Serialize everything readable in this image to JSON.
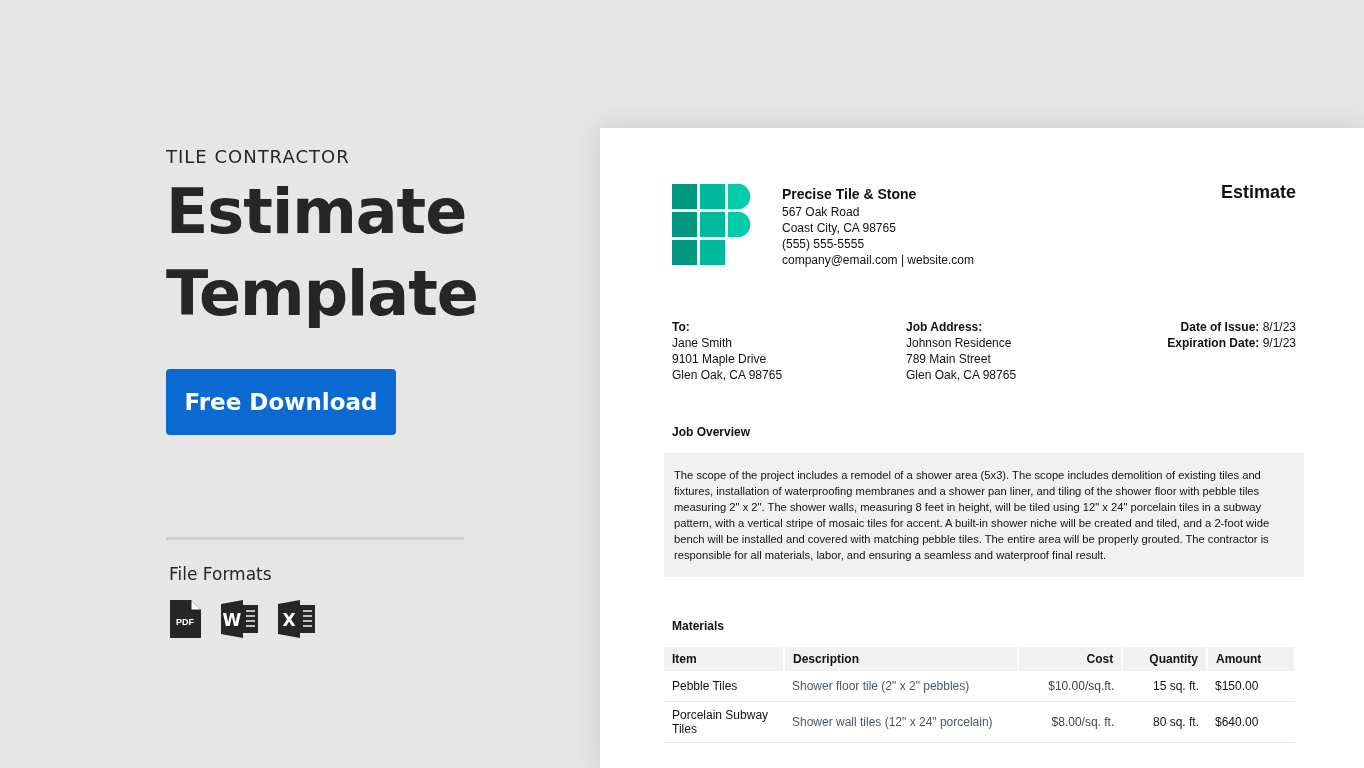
{
  "promo": {
    "eyebrow": "TILE CONTRACTOR",
    "title_lines": [
      "Estimate",
      "Template"
    ],
    "download_button": "Free Download",
    "formats_heading": "File Formats",
    "formats": [
      {
        "kind": "pdf",
        "label": "PDF"
      },
      {
        "kind": "word",
        "label": "W"
      },
      {
        "kind": "excel",
        "label": "X"
      }
    ]
  },
  "document": {
    "company": {
      "name": "Precise Tile & Stone",
      "lines": [
        "567 Oak Road",
        "Coast City, CA 98765",
        "(555) 555-5555",
        "company@email.com | website.com"
      ]
    },
    "doc_title": "Estimate",
    "to": {
      "heading": "To:",
      "lines": [
        "Jane Smith",
        "9101 Maple Drive",
        "Glen Oak, CA 98765"
      ]
    },
    "job_address": {
      "heading": "Job Address:",
      "lines": [
        "Johnson Residence",
        "789 Main Street",
        "Glen Oak, CA 98765"
      ]
    },
    "dates": [
      {
        "label": "Date of Issue:",
        "value": "8/1/23"
      },
      {
        "label": "Expiration Date:",
        "value": "9/1/23"
      }
    ],
    "overview_heading": "Job Overview",
    "overview_text": "The scope of the project includes a remodel of a shower area (5x3). The scope includes demolition of existing tiles and fixtures, installation of waterproofing membranes and a shower pan liner, and tiling of the shower floor with pebble tiles measuring 2\" x 2\". The shower walls, measuring 8 feet in height, will be tiled using 12\" x 24\" porcelain tiles in a subway pattern, with a vertical stripe of mosaic tiles for accent. A built-in shower niche will be created and tiled, and a 2-foot wide bench will be installed and covered with matching pebble tiles. The entire area will be properly grouted. The contractor is responsible for all materials, labor, and ensuring a seamless and waterproof final result.",
    "materials_heading": "Materials",
    "table": {
      "columns": [
        "Item",
        "Description",
        "Cost",
        "Quantity",
        "Amount"
      ],
      "rows": [
        [
          "Pebble Tiles",
          "Shower floor tile (2\" x 2\" pebbles)",
          "$10.00/sq.ft.",
          "15 sq. ft.",
          "$150.00"
        ],
        [
          "Porcelain Subway Tiles",
          "Shower wall tiles (12\" x 24\" porcelain)",
          "$8.00/sq. ft.",
          "80 sq. ft.",
          "$640.00"
        ]
      ]
    }
  }
}
